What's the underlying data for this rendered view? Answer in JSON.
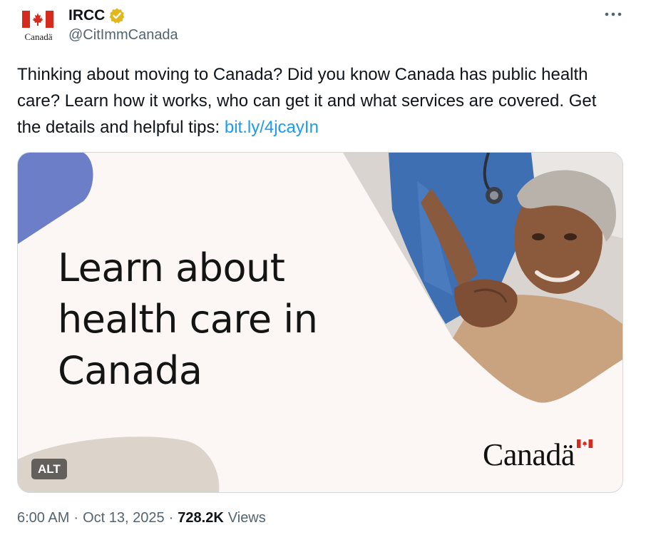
{
  "author": {
    "name": "IRCC",
    "handle": "@CitImmCanada",
    "avatar_text": "Canadä",
    "verified_color": "#e2b719"
  },
  "tweet": {
    "text": "Thinking about moving to Canada? Did you know Canada has public health care? Learn how it works, who can get it and what services are covered. Get the details and helpful tips: ",
    "link_text": "bit.ly/4jcayIn"
  },
  "media": {
    "headline_lines": [
      "Learn about",
      "health care in",
      "Canada"
    ],
    "wordmark": "Canadä",
    "alt_label": "ALT",
    "colors": {
      "background": "#fcf7f4",
      "blue_shape": "#6b7ec7",
      "beige_shape": "#dcd4cb"
    }
  },
  "meta": {
    "time": "6:00 AM",
    "separator": "·",
    "date": "Oct 13, 2025",
    "views_count": "728.2K",
    "views_label": "Views"
  },
  "icons": {
    "more": "more-horizontal-icon",
    "verified": "verified-badge-icon"
  },
  "colors": {
    "link": "#1d9bf0",
    "secondary_text": "#536471",
    "flag_red": "#d52b1e"
  }
}
